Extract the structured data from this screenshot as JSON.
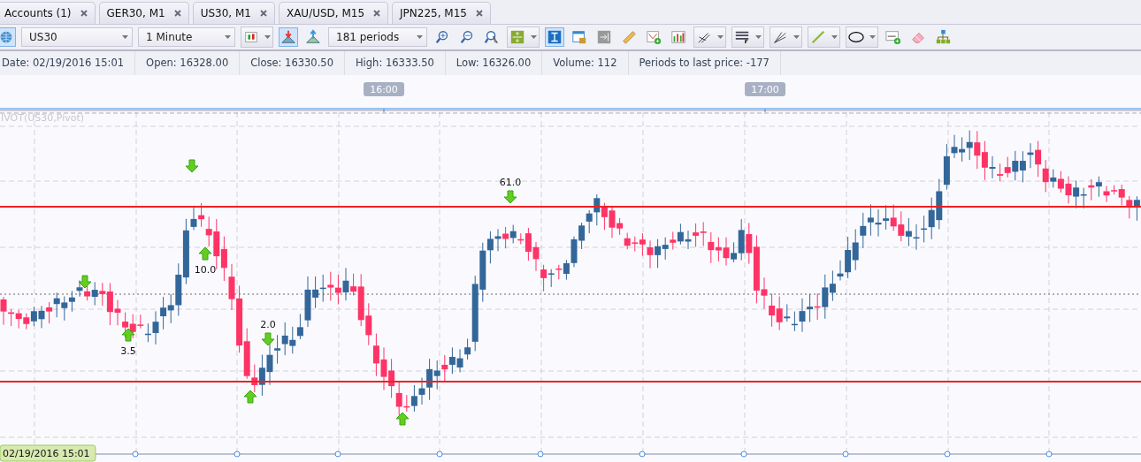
{
  "tabs": [
    {
      "label": "Accounts (1)"
    },
    {
      "label": "GER30, M1"
    },
    {
      "label": "US30, M1"
    },
    {
      "label": "XAU/USD, M15"
    },
    {
      "label": "JPN225, M15"
    }
  ],
  "toolbar": [
    {
      "kind": "icon",
      "pressed": true
    },
    {
      "kind": "select",
      "value": "US30"
    },
    {
      "kind": "select",
      "value": "1 Minute"
    },
    {
      "kind": "split",
      "pressed": false
    },
    {
      "kind": "icon",
      "pressed": true
    },
    {
      "kind": "icon",
      "pressed": false
    },
    {
      "kind": "select",
      "value": "181 periods"
    },
    {
      "kind": "icon",
      "pressed": false
    },
    {
      "kind": "icon",
      "pressed": false
    },
    {
      "kind": "icon",
      "pressed": false
    },
    {
      "kind": "split",
      "pressed": false
    },
    {
      "kind": "icon",
      "pressed": true
    },
    {
      "kind": "icon",
      "pressed": false
    },
    {
      "kind": "icon",
      "pressed": false
    },
    {
      "kind": "icon",
      "pressed": false
    },
    {
      "kind": "icon",
      "pressed": false
    },
    {
      "kind": "icon",
      "pressed": false
    },
    {
      "kind": "split",
      "pressed": false
    },
    {
      "kind": "split",
      "pressed": false
    },
    {
      "kind": "split",
      "pressed": false
    },
    {
      "kind": "split",
      "pressed": false
    },
    {
      "kind": "split",
      "pressed": false
    },
    {
      "kind": "icon",
      "pressed": false
    },
    {
      "kind": "icon",
      "pressed": false
    },
    {
      "kind": "icon",
      "pressed": false
    }
  ],
  "info_bar": [
    "Date: 02/19/2016 15:01",
    "Open: 16328.00",
    "Close: 16330.50",
    "High: 16333.50",
    "Low: 16326.00",
    "Volume: 112",
    "Periods to last price: -177"
  ],
  "chart": {
    "time_labels": [
      "16:00",
      "17:00"
    ],
    "indicator_label": "IVOT(US30,Pivot)",
    "markers": [
      {
        "kind": "down"
      },
      {
        "kind": "down"
      },
      {
        "kind": "up",
        "label": "3.5"
      },
      {
        "kind": "up",
        "label": "10.0"
      },
      {
        "kind": "down",
        "label": "2.0"
      },
      {
        "kind": "up"
      },
      {
        "kind": "up"
      },
      {
        "kind": "down",
        "label": "61.0"
      }
    ],
    "cursor_date": "02/19/2016 15:01"
  }
}
